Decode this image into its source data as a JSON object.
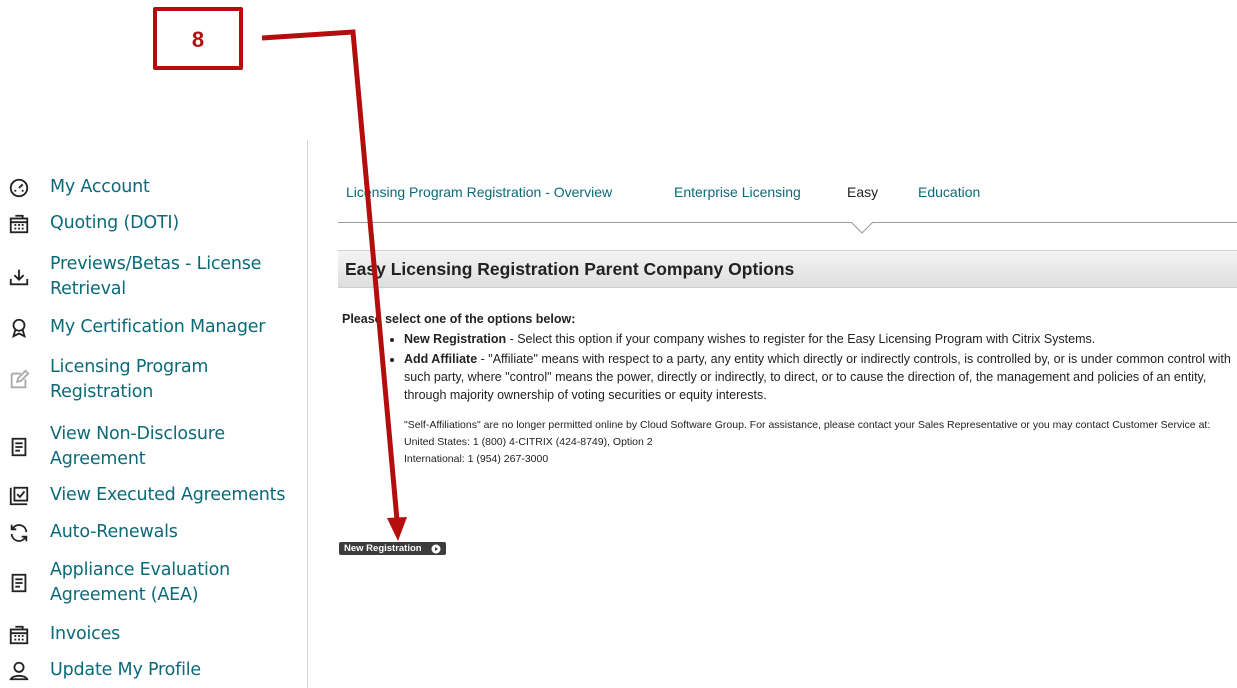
{
  "annotation": {
    "number": "8"
  },
  "sidebar": {
    "items": [
      {
        "label": "My Account",
        "icon": "speedometer-icon"
      },
      {
        "label": "Quoting (DOTI)",
        "icon": "building-icon"
      },
      {
        "label": "Previews/Betas - License Retrieval",
        "icon": "download-icon"
      },
      {
        "label": "My Certification Manager",
        "icon": "award-icon"
      },
      {
        "label": "Licensing Program Registration",
        "icon": "edit-icon"
      },
      {
        "label": "View Non-Disclosure Agreement",
        "icon": "document-icon"
      },
      {
        "label": "View Executed Agreements",
        "icon": "checkbox-document-icon"
      },
      {
        "label": "Auto-Renewals",
        "icon": "refresh-icon"
      },
      {
        "label": "Appliance Evaluation Agreement (AEA)",
        "icon": "document-icon"
      },
      {
        "label": "Invoices",
        "icon": "building-icon"
      },
      {
        "label": "Update My Profile",
        "icon": "user-icon"
      }
    ]
  },
  "tabs": [
    {
      "label": "Licensing Program Registration - Overview",
      "active": false
    },
    {
      "label": "Enterprise Licensing",
      "active": false
    },
    {
      "label": "Easy",
      "active": true
    },
    {
      "label": "Education",
      "active": false
    }
  ],
  "section": {
    "title": "Easy Licensing Registration Parent Company Options"
  },
  "content": {
    "intro": "Please select one of the options below:",
    "options": [
      {
        "name": "New Registration",
        "text": " - Select this option if your company wishes to register for the Easy Licensing Program with Citrix Systems."
      },
      {
        "name": "Add Affiliate",
        "text": " - \"Affiliate\" means with respect to a party, any entity which directly or indirectly controls, is controlled by, or is under common control with such party, where \"control\" means the power, directly or indirectly, to direct, or to cause the direction of, the management and policies of an entity, through majority ownership of voting securities or equity interests."
      }
    ],
    "notice": "\"Self-Affiliations\" are no longer permitted online by Cloud Software Group. For assistance, please contact your Sales Representative or you may contact Customer Service at:",
    "phone_us": "United States: 1 (800) 4-CITRIX (424-8749), Option 2",
    "phone_intl": "International: 1 (954) 267-3000"
  },
  "button": {
    "label": "New Registration"
  },
  "colors": {
    "link": "#0b6a7a",
    "annotation": "#b50d0d",
    "button": "#3c3c3c"
  }
}
